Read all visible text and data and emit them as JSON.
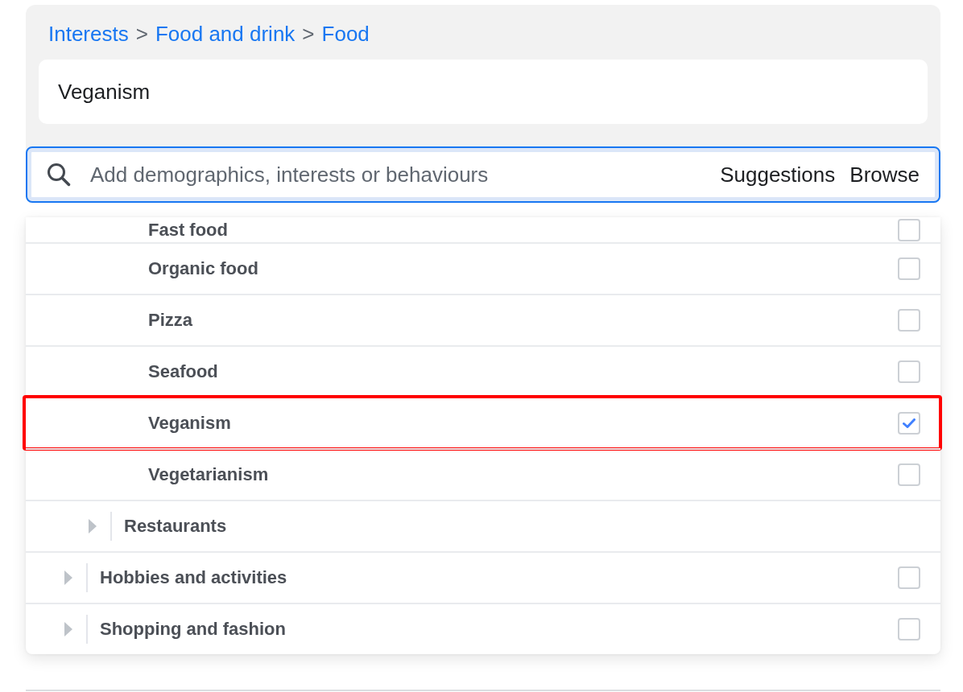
{
  "breadcrumb": [
    {
      "kind": "link",
      "text": "Interests"
    },
    {
      "kind": "separator",
      "text": ">"
    },
    {
      "kind": "link",
      "text": "Food and drink"
    },
    {
      "kind": "separator",
      "text": ">"
    },
    {
      "kind": "link",
      "text": "Food"
    }
  ],
  "selected_items": [
    {
      "label": "Veganism"
    }
  ],
  "search": {
    "placeholder": "Add demographics, interests or behaviours",
    "options": [
      {
        "label": "Suggestions"
      },
      {
        "label": "Browse"
      }
    ]
  },
  "tree": [
    {
      "children": [
        {
          "children": [
            {
              "kind": "leaf",
              "label": "Fast food",
              "checked": false,
              "highlighted": false
            },
            {
              "kind": "leaf",
              "label": "Organic food",
              "checked": false,
              "highlighted": false
            },
            {
              "kind": "leaf",
              "label": "Pizza",
              "checked": false,
              "highlighted": false
            },
            {
              "kind": "leaf",
              "label": "Seafood",
              "checked": false,
              "highlighted": false
            },
            {
              "kind": "leaf",
              "label": "Veganism",
              "checked": true,
              "highlighted": true
            },
            {
              "kind": "leaf",
              "label": "Vegetarianism",
              "checked": false,
              "highlighted": false
            }
          ]
        },
        {
          "kind": "category",
          "label": "Restaurants",
          "expanded": false,
          "highlighted": false
        }
      ]
    },
    {
      "kind": "category",
      "label": "Hobbies and activities",
      "expanded": false,
      "checked": false,
      "highlighted": false
    },
    {
      "kind": "category",
      "label": "Shopping and fashion",
      "expanded": false,
      "checked": false,
      "highlighted": false
    }
  ]
}
